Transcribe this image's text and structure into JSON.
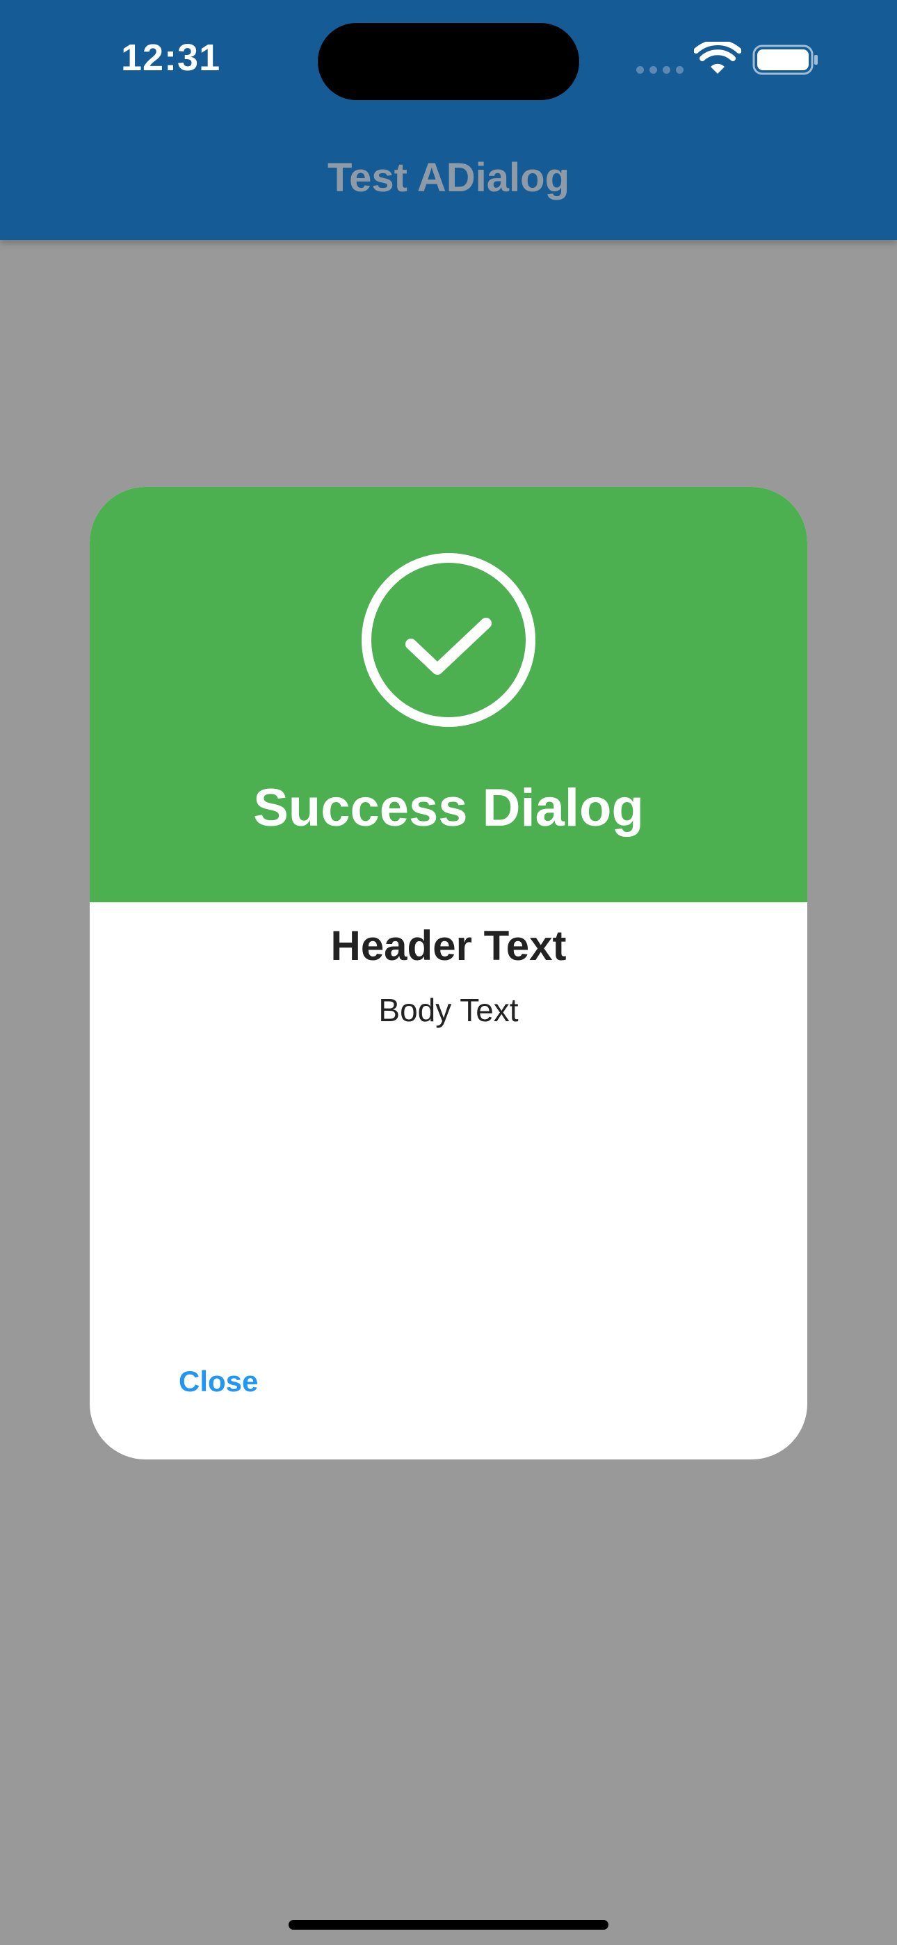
{
  "status_bar": {
    "time": "12:31"
  },
  "app_bar": {
    "title": "Test ADialog"
  },
  "dialog": {
    "title": "Success Dialog",
    "header_text": "Header Text",
    "body_text": "Body Text",
    "close_label": "Close",
    "accent_color": "#4caf50",
    "icon": "check-circle-icon"
  },
  "colors": {
    "app_bar": "#155b96",
    "overlay": "#999999",
    "button_text": "#2196f3"
  }
}
